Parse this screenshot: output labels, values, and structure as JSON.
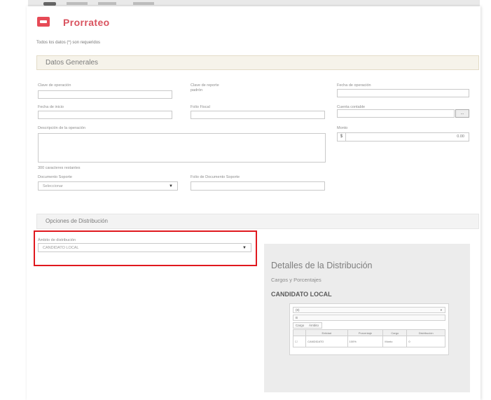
{
  "page": {
    "title": "Prorrateo",
    "subtitle": "Todos los datos (*) son requeridos"
  },
  "datos_generales": {
    "title": "Datos Generales",
    "fields": {
      "clave_operacion": {
        "label": "Clave de operación"
      },
      "clave_reporte": {
        "label": "Clave de reporte",
        "value": "padrón"
      },
      "fecha_operacion": {
        "label": "Fecha de operación"
      },
      "fecha_inicio": {
        "label": "Fecha de inicio"
      },
      "folio_fiscal": {
        "label": "Folio Fiscal"
      },
      "cuenta_contable": {
        "label": "Cuenta contable"
      },
      "descripcion": {
        "label": "Descripción de la operación"
      },
      "monto": {
        "label": "Monto",
        "value": "0.00"
      },
      "chars_note": {
        "label": "300 caracteres restantes"
      },
      "documento_soporte": {
        "label": "Documento Soporte",
        "selected": "Seleccionar"
      },
      "folio_documento_soporte": {
        "label": "Folio de Documento Soporte"
      }
    },
    "dots_button": "..."
  },
  "opciones": {
    "title": "Opciones de Distribución",
    "ambito_label": "Ámbito de distribución",
    "ambito_selected": "CANDIDATO LOCAL"
  },
  "detalles": {
    "title": "Detalles de la Distribución",
    "subtitle": "Cargos y Porcentajes",
    "candidate": "CANDIDATO LOCAL",
    "mini_filter": "(8)",
    "mini_search": "B",
    "mini_tabs": [
      "Cargo",
      "Ámbito"
    ],
    "table_headers": [
      "",
      "Entidad",
      "Porcentaje",
      "Cargo",
      "Distribución"
    ],
    "table_row": [
      "",
      "CANDIDATO",
      "100%",
      "Monto",
      "0"
    ]
  }
}
